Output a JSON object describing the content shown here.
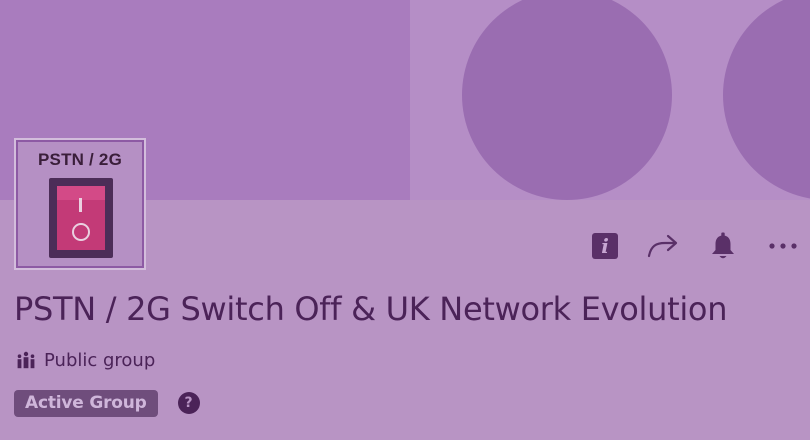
{
  "group": {
    "avatar_text": "PSTN / 2G",
    "title": "PSTN / 2G Switch Off & UK Network Evolution",
    "privacy_label": "Public group",
    "status_badge": "Active Group",
    "help_glyph": "?"
  },
  "actions": [
    {
      "name": "info",
      "icon": "info-icon"
    },
    {
      "name": "share",
      "icon": "share-arrow-icon"
    },
    {
      "name": "notifications",
      "icon": "bell-icon"
    },
    {
      "name": "more",
      "icon": "more-dots-icon"
    }
  ],
  "colors": {
    "background": "#b894c4",
    "cover_left": "#a97cbe",
    "cover_right": "#b58ec6",
    "cover_circles": "#9a6db1",
    "text": "#4b2358",
    "icon": "#5a3068",
    "badge_bg": "#6f4d7c",
    "badge_text": "#cfb6da",
    "switch_body": "#c33a77",
    "switch_frame": "#4c2d58"
  }
}
